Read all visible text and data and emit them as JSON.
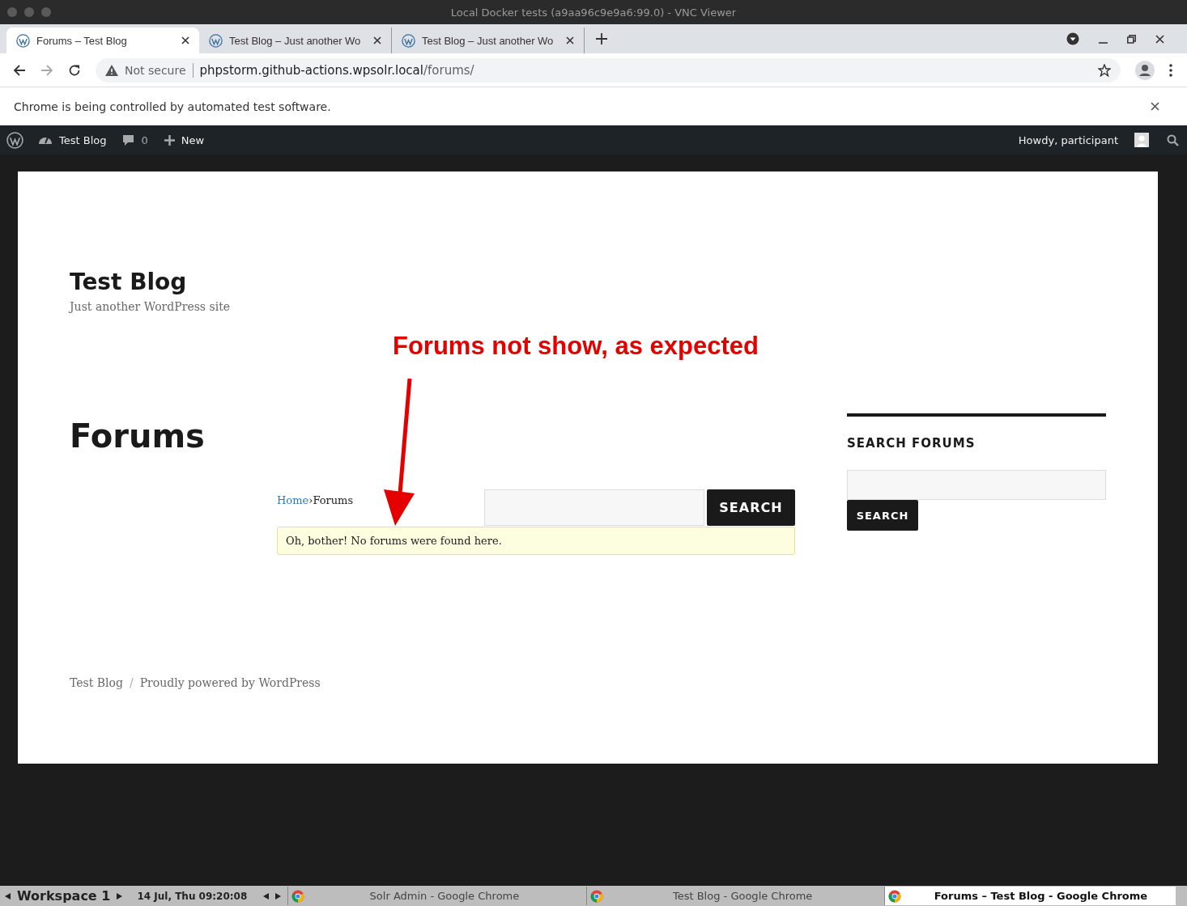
{
  "window": {
    "title": "Local Docker tests (a9aa96c9e9a6:99.0) - VNC Viewer"
  },
  "tabs": [
    {
      "title": "Forums – Test Blog",
      "selected": true
    },
    {
      "title": "Test Blog – Just another Wo",
      "selected": false
    },
    {
      "title": "Test Blog – Just another Wo",
      "selected": false
    }
  ],
  "address_bar": {
    "security": "Not secure",
    "host": "phpstorm.github-actions.wpsolr.local",
    "path": "/forums/"
  },
  "infobar": {
    "message": "Chrome is being controlled by automated test software."
  },
  "admin_bar": {
    "site": "Test Blog",
    "comments": "0",
    "new": "New",
    "greeting": "Howdy, participant"
  },
  "site": {
    "title": "Test Blog",
    "tagline": "Just another WordPress site"
  },
  "page": {
    "heading": "Forums",
    "breadcrumb": {
      "home": "Home",
      "separator": "›",
      "current": "Forums"
    },
    "search_button": "SEARCH",
    "notice": "Oh, bother! No forums were found here."
  },
  "sidebar": {
    "heading": "SEARCH FORUMS",
    "search_button": "SEARCH"
  },
  "footer": {
    "site": "Test Blog",
    "separator": "/",
    "powered": "Proudly powered by WordPress"
  },
  "annotation": {
    "text": "Forums not show, as expected"
  },
  "taskbar": {
    "workspace": "Workspace 1",
    "clock": "14 Jul, Thu 09:20:08",
    "windows": [
      {
        "title": "Solr Admin - Google Chrome",
        "selected": false
      },
      {
        "title": "Test Blog - Google Chrome",
        "selected": false
      },
      {
        "title": "Forums – Test Blog - Google Chrome",
        "selected": true
      }
    ]
  }
}
